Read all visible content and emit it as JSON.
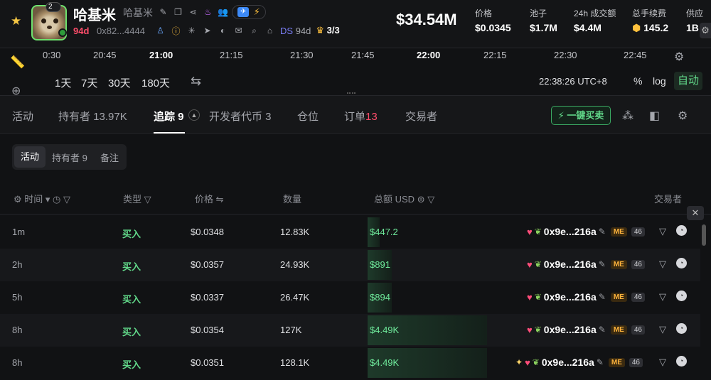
{
  "token": {
    "name": "哈基米",
    "symbol": "哈基米",
    "age": "94d",
    "address": "0x82...4444",
    "avatar_badge": "2",
    "ds_label": "DS",
    "ds_age": "94d",
    "holders_score": "3/3"
  },
  "market": {
    "market_cap": "$34.54M",
    "stats": [
      {
        "label": "价格",
        "value": "$0.0345"
      },
      {
        "label": "池子",
        "value": "$1.7M"
      },
      {
        "label": "24h 成交额",
        "value": "$4.4M"
      },
      {
        "label": "总手续费",
        "value": "145.2"
      },
      {
        "label": "供应",
        "value": "1B"
      }
    ]
  },
  "timeline": {
    "ticks": [
      "0:30",
      "20:45",
      "21:00",
      "21:15",
      "21:30",
      "21:45",
      "22:00",
      "22:15",
      "22:30",
      "22:45"
    ],
    "ranges": [
      "1天",
      "7天",
      "30天",
      "180天"
    ],
    "clock": "22:38:26 UTC+8",
    "percent": "%",
    "log": "log",
    "auto": "自动"
  },
  "tabs": {
    "activity": "活动",
    "holders": "持有者 13.97K",
    "tracking": "追踪 9",
    "dev_tokens": "开发者代币 3",
    "positions": "仓位",
    "orders_label": "订单",
    "orders_count": "13",
    "traders": "交易者",
    "one_click_buy": "一键买卖"
  },
  "subtabs": [
    "活动",
    "持有者 9",
    "备注"
  ],
  "table": {
    "headers": {
      "time": "时间",
      "type": "类型",
      "price": "价格",
      "qty": "数量",
      "total": "总额 USD",
      "trader": "交易者"
    },
    "rows": [
      {
        "time": "1m",
        "type": "买入",
        "price": "$0.0348",
        "qty": "12.83K",
        "total": "$447.2",
        "fill": 0.1,
        "trader": "0x9e...216a",
        "tag": "ME",
        "count": "46",
        "icon": "heart"
      },
      {
        "time": "2h",
        "type": "买入",
        "price": "$0.0357",
        "qty": "24.93K",
        "total": "$891",
        "fill": 0.2,
        "trader": "0x9e...216a",
        "tag": "ME",
        "count": "46",
        "icon": "heart"
      },
      {
        "time": "5h",
        "type": "买入",
        "price": "$0.0337",
        "qty": "26.47K",
        "total": "$894",
        "fill": 0.2,
        "trader": "0x9e...216a",
        "tag": "ME",
        "count": "46",
        "icon": "heart"
      },
      {
        "time": "8h",
        "type": "买入",
        "price": "$0.0354",
        "qty": "127K",
        "total": "$4.49K",
        "fill": 1.0,
        "trader": "0x9e...216a",
        "tag": "ME",
        "count": "46",
        "icon": "heart"
      },
      {
        "time": "8h",
        "type": "买入",
        "price": "$0.0351",
        "qty": "128.1K",
        "total": "$4.49K",
        "fill": 1.0,
        "trader": "0x9e...216a",
        "tag": "ME",
        "count": "46",
        "icon": "spark-heart"
      }
    ]
  },
  "colors": {
    "buy": "#62d98a",
    "accent_red": "#ff4d6a",
    "background": "#111214"
  }
}
